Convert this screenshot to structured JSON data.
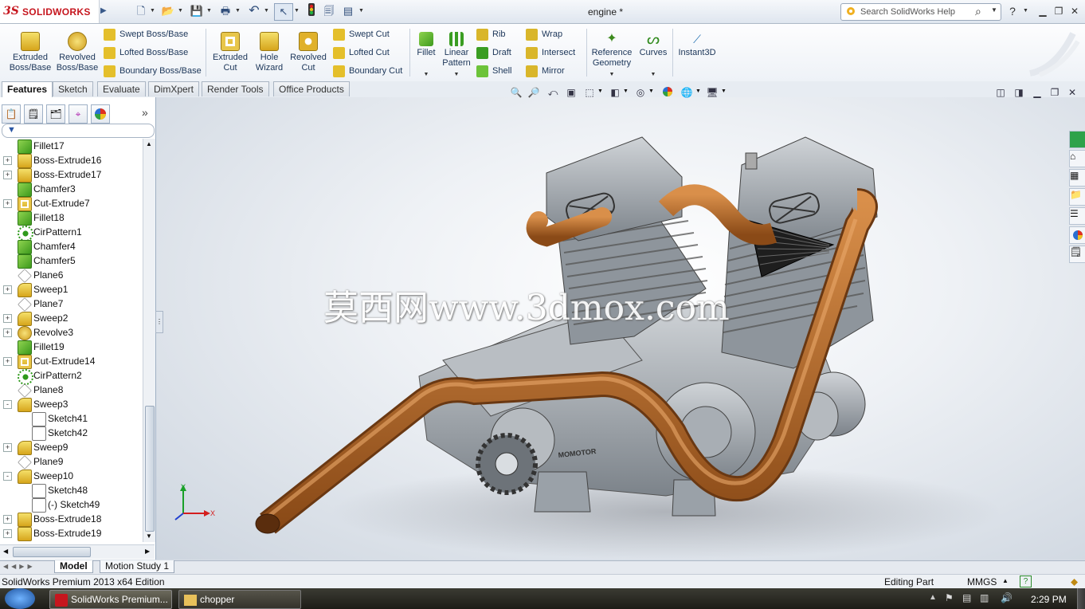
{
  "titlebar": {
    "logo_prefix": "3S",
    "logo_text": "SOLIDWORKS",
    "document_title": "engine *",
    "search_placeholder": "Search SolidWorks Help",
    "help_icon": "?"
  },
  "command_manager": {
    "extruded_boss": "Extruded\nBoss/Base",
    "revolved_boss": "Revolved\nBoss/Base",
    "swept_boss": "Swept Boss/Base",
    "lofted_boss": "Lofted Boss/Base",
    "boundary_boss": "Boundary Boss/Base",
    "extruded_cut": "Extruded\nCut",
    "hole_wizard": "Hole\nWizard",
    "revolved_cut": "Revolved\nCut",
    "swept_cut": "Swept Cut",
    "lofted_cut": "Lofted Cut",
    "boundary_cut": "Boundary Cut",
    "fillet": "Fillet",
    "linear_pattern": "Linear\nPattern",
    "rib": "Rib",
    "draft": "Draft",
    "shell": "Shell",
    "wrap": "Wrap",
    "intersect": "Intersect",
    "mirror": "Mirror",
    "reference_geometry": "Reference\nGeometry",
    "curves": "Curves",
    "instant3d": "Instant3D"
  },
  "tabs": [
    "Features",
    "Sketch",
    "Evaluate",
    "DimXpert",
    "Render Tools",
    "Office Products"
  ],
  "tree": [
    {
      "label": "Fillet17",
      "level": 0,
      "expand": "",
      "icon": "fillet"
    },
    {
      "label": "Boss-Extrude16",
      "level": 0,
      "expand": "+",
      "icon": "extrude"
    },
    {
      "label": "Boss-Extrude17",
      "level": 0,
      "expand": "+",
      "icon": "extrude"
    },
    {
      "label": "Chamfer3",
      "level": 0,
      "expand": "",
      "icon": "fillet"
    },
    {
      "label": "Cut-Extrude7",
      "level": 0,
      "expand": "+",
      "icon": "cut"
    },
    {
      "label": "Fillet18",
      "level": 0,
      "expand": "",
      "icon": "fillet"
    },
    {
      "label": "CirPattern1",
      "level": 0,
      "expand": "",
      "icon": "pattern"
    },
    {
      "label": "Chamfer4",
      "level": 0,
      "expand": "",
      "icon": "fillet"
    },
    {
      "label": "Chamfer5",
      "level": 0,
      "expand": "",
      "icon": "fillet"
    },
    {
      "label": "Plane6",
      "level": 0,
      "expand": "",
      "icon": "plane"
    },
    {
      "label": "Sweep1",
      "level": 0,
      "expand": "+",
      "icon": "sweep"
    },
    {
      "label": "Plane7",
      "level": 0,
      "expand": "",
      "icon": "plane"
    },
    {
      "label": "Sweep2",
      "level": 0,
      "expand": "+",
      "icon": "sweep"
    },
    {
      "label": "Revolve3",
      "level": 0,
      "expand": "+",
      "icon": "revolve"
    },
    {
      "label": "Fillet19",
      "level": 0,
      "expand": "",
      "icon": "fillet"
    },
    {
      "label": "Cut-Extrude14",
      "level": 0,
      "expand": "+",
      "icon": "cut"
    },
    {
      "label": "CirPattern2",
      "level": 0,
      "expand": "",
      "icon": "pattern"
    },
    {
      "label": "Plane8",
      "level": 0,
      "expand": "",
      "icon": "plane"
    },
    {
      "label": "Sweep3",
      "level": 0,
      "expand": "-",
      "icon": "sweep"
    },
    {
      "label": "Sketch41",
      "level": 1,
      "expand": "",
      "icon": "sketch"
    },
    {
      "label": "Sketch42",
      "level": 1,
      "expand": "",
      "icon": "sketch"
    },
    {
      "label": "Sweep9",
      "level": 0,
      "expand": "+",
      "icon": "sweep"
    },
    {
      "label": "Plane9",
      "level": 0,
      "expand": "",
      "icon": "plane"
    },
    {
      "label": "Sweep10",
      "level": 0,
      "expand": "-",
      "icon": "sweep"
    },
    {
      "label": "Sketch48",
      "level": 1,
      "expand": "",
      "icon": "sketch"
    },
    {
      "label": "(-) Sketch49",
      "level": 1,
      "expand": "",
      "icon": "sketch"
    },
    {
      "label": "Boss-Extrude18",
      "level": 0,
      "expand": "+",
      "icon": "extrude"
    },
    {
      "label": "Boss-Extrude19",
      "level": 0,
      "expand": "+",
      "icon": "extrude"
    }
  ],
  "viewport": {
    "watermark": "莫西网www.3dmox.com",
    "triad_x": "X",
    "triad_y": "Y",
    "engine_label": "MOMOTOR"
  },
  "bottom_tabs": [
    "Model",
    "Motion Study 1"
  ],
  "status": {
    "edition": "SolidWorks Premium 2013 x64 Edition",
    "mode": "Editing Part",
    "units": "MMGS",
    "units_arrow": "▲"
  },
  "taskbar": {
    "app1": "SolidWorks Premium...",
    "app2": "chopper",
    "clock": "2:29 PM"
  },
  "colors": {
    "brand_red": "#c6161e",
    "tube_copper": "#b86a2a",
    "engine_grey": "#9aa1a8"
  }
}
